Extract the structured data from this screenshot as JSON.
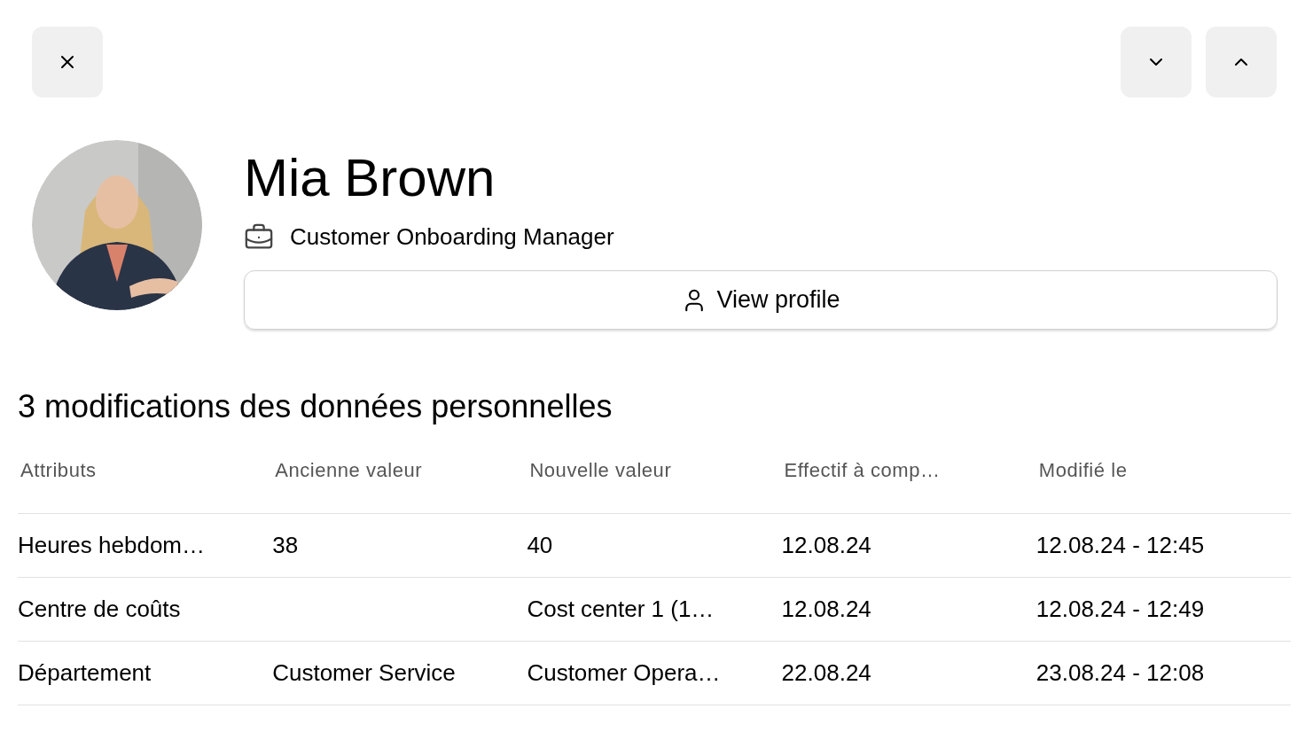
{
  "person": {
    "name": "Mia Brown",
    "job_title": "Customer Onboarding Manager",
    "view_profile": "View profile"
  },
  "changes": {
    "title": "3 modifications des données personnelles",
    "columns": [
      "Attributs",
      "Ancienne valeur",
      "Nouvelle valeur",
      "Effectif à comp…",
      "Modifié le"
    ],
    "rows": [
      [
        "Heures hebdom…",
        "38",
        "40",
        "12.08.24",
        "12.08.24 - 12:45"
      ],
      [
        "Centre de coûts",
        "",
        "Cost center 1 (1…",
        "12.08.24",
        "12.08.24 - 12:49"
      ],
      [
        "Département",
        "Customer Service",
        "Customer Opera…",
        "22.08.24",
        "23.08.24 - 12:08"
      ]
    ]
  }
}
